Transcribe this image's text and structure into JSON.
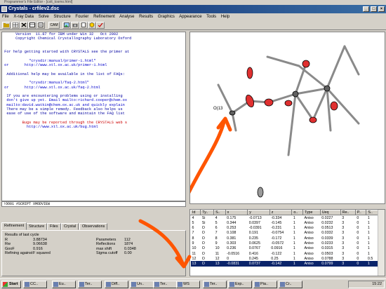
{
  "window": {
    "top_caption": "Programmer's File Editor - [cstt_tosmo.html]",
    "title": "Crystals - crfilev2.dsc"
  },
  "menu": [
    "File",
    "X-ray Data",
    "Solve",
    "Structure",
    "Fourier",
    "Refinement",
    "Analyse",
    "Results",
    "Graphics",
    "Appearance",
    "Tools",
    "Help"
  ],
  "toolbar": {
    "cam_label": "CAM"
  },
  "text_output": [
    {
      "text": "      Version  11.87 for IBM under Win 32   Oct 2002",
      "cls": "bn"
    },
    {
      "text": "      Copyright Chemical Crystallography Laboratory Oxford",
      "cls": "bn"
    },
    {
      "text": "",
      "cls": ""
    },
    {
      "text": "",
      "cls": ""
    },
    {
      "text": " For help getting started with CRYSTALS see the primer at",
      "cls": "bn"
    },
    {
      "text": "",
      "cls": ""
    },
    {
      "text": "            \"crysdir:manual/primer-1.html\"",
      "cls": "lnk"
    },
    {
      "text": " or       http://www.xtl.ox.ac.uk/primer-1.html",
      "cls": "lnk"
    },
    {
      "text": "",
      "cls": ""
    },
    {
      "text": "  Additional help may be available in the list of FAQs:",
      "cls": "bn"
    },
    {
      "text": "",
      "cls": ""
    },
    {
      "text": "            \"crysdir:manual/faq-2.html\"",
      "cls": "lnk"
    },
    {
      "text": " or       http://www.xtl.ox.ac.uk/faq-2.html",
      "cls": "lnk"
    },
    {
      "text": "",
      "cls": ""
    },
    {
      "text": "  If you are encountering problems using or installing",
      "cls": "bn"
    },
    {
      "text": "  don't give up yet. Email mailto:richard.cooper@chem.ox",
      "cls": "lnk"
    },
    {
      "text": "  mailto:david.watkin@chem.ox.ac.uk and quickly explain",
      "cls": "lnk"
    },
    {
      "text": "  There may be a simple remedy. Feedback also helps us",
      "cls": "bn"
    },
    {
      "text": "  ease of use of the software and maintain the FAQ list",
      "cls": "bn"
    },
    {
      "text": "",
      "cls": ""
    },
    {
      "text": "         Bugs may be reported through the CRYSTALS web s",
      "cls": "red"
    },
    {
      "text": "           http://www.xtl.ox.ac.uk/bug.html",
      "cls": "lnk"
    },
    {
      "text": "",
      "cls": ""
    },
    {
      "text": "",
      "cls": ""
    },
    {
      "text": "",
      "cls": ""
    },
    {
      "text": "",
      "cls": ""
    },
    {
      "text": "",
      "cls": ""
    },
    {
      "text": "",
      "cls": ""
    },
    {
      "text": "",
      "cls": ""
    },
    {
      "text": "",
      "cls": ""
    },
    {
      "text": "",
      "cls": ""
    },
    {
      "text": "",
      "cls": ""
    },
    {
      "text": "",
      "cls": ""
    },
    {
      "text": "",
      "cls": ""
    },
    {
      "text": "",
      "cls": ""
    },
    {
      "text": "",
      "cls": ""
    },
    {
      "text": "",
      "cls": ""
    },
    {
      "text": "",
      "cls": ""
    }
  ],
  "command_line": "!OO01 #SCRIPT XMODVIEW",
  "tabs": [
    "Refinement",
    "Structure",
    "Files",
    "Crystal",
    "Observations"
  ],
  "refinement": {
    "heading": "Results of last cycle",
    "left": [
      {
        "k": "R",
        "v": "3.88734"
      },
      {
        "k": "Rw",
        "v": "9.06638"
      },
      {
        "k": "GooF",
        "v": "0.916"
      },
      {
        "k": "Refining against",
        "v": "F squared"
      }
    ],
    "right": [
      {
        "k": "Parameters",
        "v": "112"
      },
      {
        "k": "Reflections",
        "v": "1874"
      },
      {
        "k": "max shift",
        "v": "0.0348"
      },
      {
        "k": "Sigma cutoff",
        "v": "0.00"
      }
    ]
  },
  "mol_label": "O(13",
  "atom_table": {
    "headers": [
      "Id",
      "Ty..",
      "S..",
      "x",
      "y",
      "z",
      "o..",
      "Type",
      "Ueq",
      "Re..",
      "P..",
      "S.."
    ],
    "rows": [
      [
        "4",
        "Si",
        "4",
        "0.175",
        "-0.0713",
        "-0.334",
        "1",
        "Aniso",
        "0.0227",
        "3",
        "0",
        "1"
      ],
      [
        "5",
        "Si",
        "5",
        "0.344",
        "0.0397",
        "-0.145",
        "1",
        "Aniso",
        "0.0232",
        "3",
        "0",
        "1"
      ],
      [
        "6",
        "O",
        "6",
        "0.253",
        "-0.0391",
        "-0.231",
        "1",
        "Aniso",
        "0.0513",
        "3",
        "0",
        "1"
      ],
      [
        "7",
        "O",
        "7",
        "0.108",
        "0.191",
        "-0.0754",
        "1",
        "Aniso",
        "0.0332",
        "3",
        "0",
        "1"
      ],
      [
        "8",
        "O",
        "8",
        "0.381",
        "0.235",
        "-0.172",
        "1",
        "Aniso",
        "0.0339",
        "3",
        "0",
        "1"
      ],
      [
        "9",
        "O",
        "9",
        "0.303",
        "0.0625",
        "-0.0572",
        "1",
        "Aniso",
        "0.0233",
        "3",
        "0",
        "1"
      ],
      [
        "10",
        "O",
        "10",
        "0.236",
        "0.0767",
        "0.0916",
        "1",
        "Aniso",
        "0.0315",
        "3",
        "0",
        "1"
      ],
      [
        "11",
        "O",
        "11",
        "-0.0516",
        "0.416",
        "-0.122",
        "1",
        "Aniso",
        "0.0503",
        "3",
        "0",
        "1"
      ],
      [
        "12",
        "O",
        "12",
        "0",
        "0.245",
        "0.25",
        "1",
        "Aniso",
        "0.0788",
        "3",
        "0",
        "0.5"
      ],
      [
        "13",
        "O",
        "13",
        "-0.0831",
        "0.0737",
        "-0.142",
        "1",
        "Aniso",
        "0.0799",
        "3",
        "0",
        "1"
      ]
    ],
    "selected_index": 9
  },
  "taskbar": {
    "start": "Start",
    "tasks": [
      "CC..",
      "Eu..",
      "Ter..",
      "Diff..",
      "Un..",
      "Ter..",
      "WS",
      "Ter..",
      "Exp..",
      "Pia..",
      "Cr.."
    ],
    "clock": "15:22"
  }
}
